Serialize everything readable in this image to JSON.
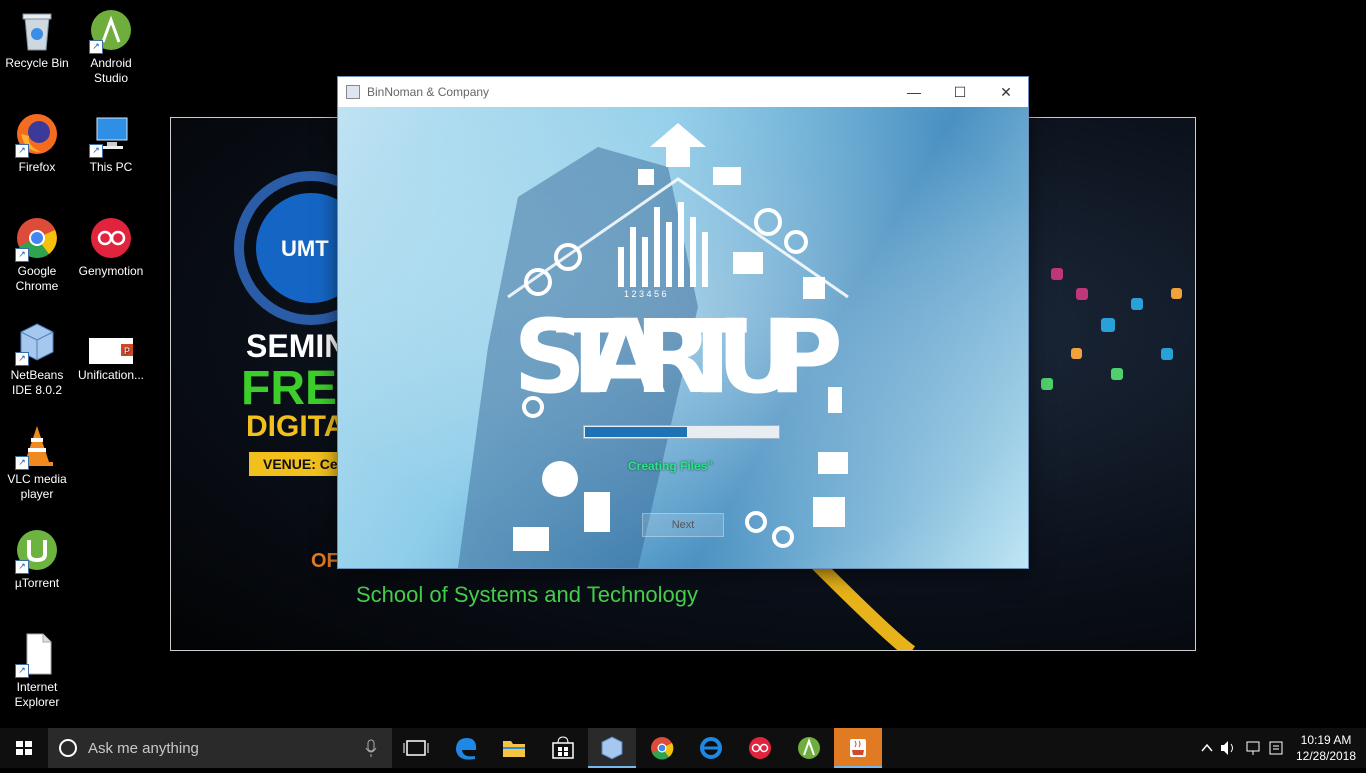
{
  "desktop": {
    "icons": [
      {
        "label": "Recycle Bin"
      },
      {
        "label": "Android Studio"
      },
      {
        "label": "Firefox"
      },
      {
        "label": "This PC"
      },
      {
        "label": "Google Chrome"
      },
      {
        "label": "Genymotion"
      },
      {
        "label": "NetBeans IDE 8.0.2"
      },
      {
        "label": "Unification..."
      },
      {
        "label": "VLC media player"
      },
      {
        "label": "µTorrent"
      },
      {
        "label": "Internet Explorer"
      }
    ]
  },
  "slide": {
    "badge": "UMT",
    "line1": "SEMIN",
    "line2": "FRE",
    "line3": "DIGITA",
    "venue": "VENUE: Ce",
    "or_text": "OF",
    "school": "School of Systems and Technology"
  },
  "window": {
    "title": "BinNoman & Company",
    "minimize_icon": "minimize-icon",
    "maximize_icon": "maximize-icon",
    "close_icon": "close-icon",
    "splash_word": "STARTUP",
    "chart_ticks": "1 2 3 4 5 6",
    "progress_fraction": 0.53,
    "status_text": "Creating Files\"",
    "next_label": "Next"
  },
  "taskbar": {
    "search_placeholder": "Ask me anything",
    "time": "10:19 AM",
    "date": "12/28/2018"
  },
  "colors": {
    "taskbar_bg": "#0f0f0f",
    "progress_fill": "#1f72b6",
    "status_green": "#2fe18d",
    "taskbar_active": "#76b9ed"
  }
}
